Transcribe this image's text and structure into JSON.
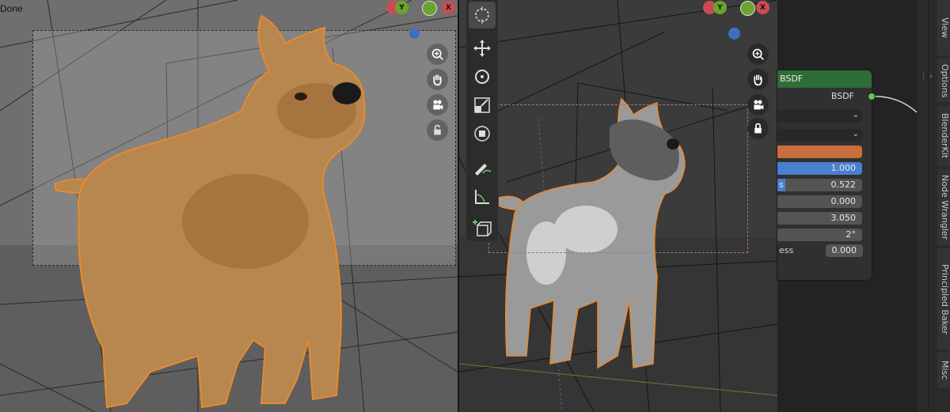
{
  "status": {
    "done_label": "Done"
  },
  "gizmo": {
    "y_label": "Y",
    "x_label": "X"
  },
  "node": {
    "header": "BSDF",
    "output_label": "BSDF",
    "base_color": "#c8703d",
    "fields": [
      {
        "label": "",
        "value": "1.000",
        "fill_fraction": 1.0
      },
      {
        "label": "s",
        "value": "0.522",
        "fill_fraction": 0.0
      },
      {
        "label": "",
        "value": "0.000",
        "fill_fraction": 0.0
      },
      {
        "label": "",
        "value": "3.050",
        "fill_fraction": 0.0
      },
      {
        "label": "",
        "value": "2°",
        "fill_fraction": 0.0
      },
      {
        "label": "ess",
        "value": "0.000",
        "fill_fraction": 0.0
      }
    ]
  },
  "sidebar": {
    "tabs": [
      "View",
      "Options",
      "BlenderKit",
      "Node Wrangler",
      "Principled Baker",
      "Misc"
    ]
  },
  "colors": {
    "selection_outline": "#e98a2d",
    "node_header": "#2f6d36",
    "socket": "#61c554",
    "value_blue": "#4a7fcf"
  }
}
